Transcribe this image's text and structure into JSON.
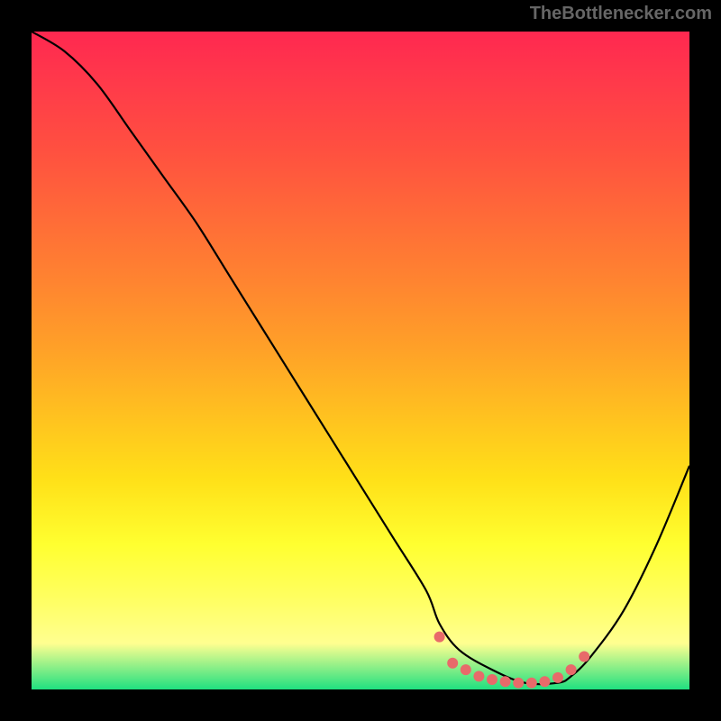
{
  "attribution": "TheBottlenecker.com",
  "chart_data": {
    "type": "line",
    "title": "",
    "xlabel": "",
    "ylabel": "",
    "xlim": [
      0,
      100
    ],
    "ylim": [
      0,
      100
    ],
    "series": [
      {
        "name": "bottleneck-curve",
        "x": [
          0,
          5,
          10,
          15,
          20,
          25,
          30,
          35,
          40,
          45,
          50,
          55,
          60,
          62,
          65,
          70,
          75,
          80,
          82,
          85,
          90,
          95,
          100
        ],
        "y": [
          100,
          97,
          92,
          85,
          78,
          71,
          63,
          55,
          47,
          39,
          31,
          23,
          15,
          10,
          6,
          3,
          1,
          1,
          2,
          5,
          12,
          22,
          34
        ]
      }
    ],
    "markers": {
      "name": "highlight-dots",
      "color": "#e86a6a",
      "points": [
        {
          "x": 62,
          "y": 8
        },
        {
          "x": 64,
          "y": 4
        },
        {
          "x": 66,
          "y": 3
        },
        {
          "x": 68,
          "y": 2
        },
        {
          "x": 70,
          "y": 1.5
        },
        {
          "x": 72,
          "y": 1.2
        },
        {
          "x": 74,
          "y": 1
        },
        {
          "x": 76,
          "y": 1
        },
        {
          "x": 78,
          "y": 1.2
        },
        {
          "x": 80,
          "y": 1.8
        },
        {
          "x": 82,
          "y": 3
        },
        {
          "x": 84,
          "y": 5
        }
      ]
    },
    "gradient_stops": [
      {
        "pos": 0,
        "color": "#ff2850"
      },
      {
        "pos": 50,
        "color": "#ffb020"
      },
      {
        "pos": 85,
        "color": "#ffff40"
      },
      {
        "pos": 100,
        "color": "#20e080"
      }
    ]
  }
}
